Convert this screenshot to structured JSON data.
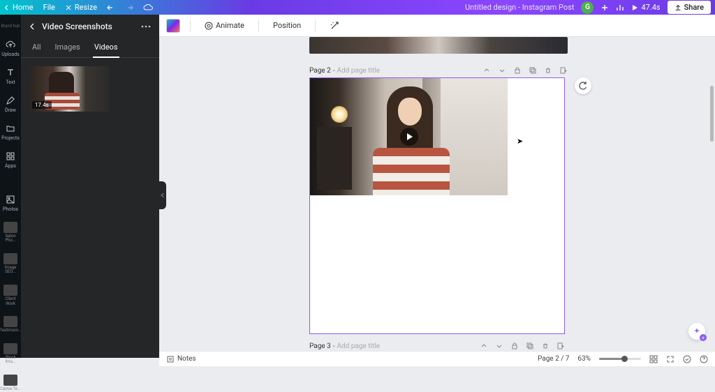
{
  "header": {
    "home": "Home",
    "file": "File",
    "resize": "Resize",
    "doc_title": "Untitled design - Instagram Post",
    "avatar_initial": "G",
    "duration": "47.4s",
    "share": "Share"
  },
  "toolbar": {
    "animate": "Animate",
    "position": "Position"
  },
  "nav": {
    "uploads": "Uploads",
    "text": "Text",
    "draw": "Draw",
    "projects": "Projects",
    "apps": "Apps",
    "photos": "Photos",
    "folders": [
      {
        "label": "Salon Pho..."
      },
      {
        "label": "Image SEO..."
      },
      {
        "label": "Client Work"
      },
      {
        "label": "Testimoni..."
      },
      {
        "label": "Stock Ima..."
      },
      {
        "label": "Canva Te..."
      }
    ]
  },
  "side_panel": {
    "title": "Video Screenshots",
    "tabs": {
      "all": "All",
      "images": "Images",
      "videos": "Videos"
    },
    "thumb_duration": "17.4s"
  },
  "pages": {
    "p2_label": "Page 2",
    "p3_label": "Page 3",
    "dash": " - ",
    "placeholder": "Add page title"
  },
  "status": {
    "notes": "Notes",
    "page_indicator": "Page 2 / 7",
    "zoom": "63%"
  }
}
